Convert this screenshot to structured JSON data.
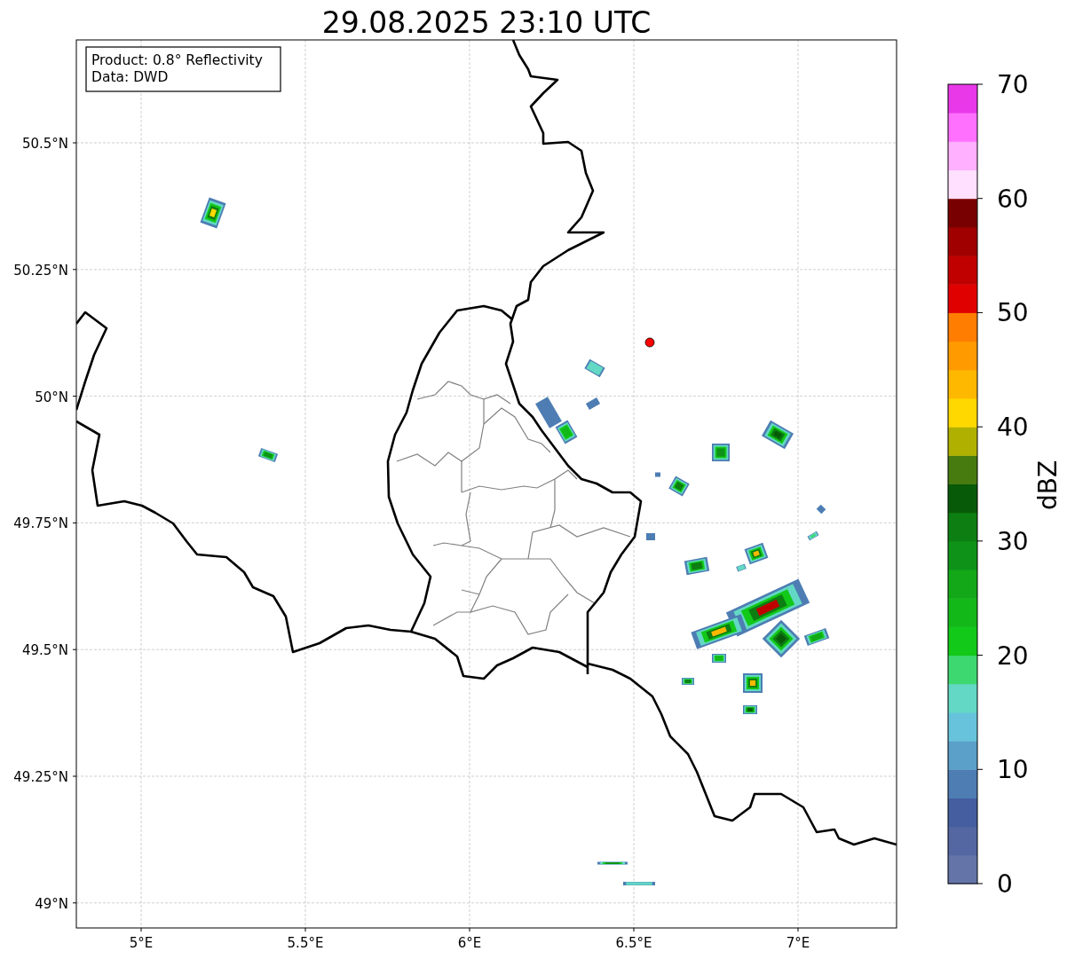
{
  "title": "29.08.2025 23:10 UTC",
  "info_box": [
    "Product: 0.8° Reflectivity",
    "Data: DWD"
  ],
  "x_ticks": [
    "5°E",
    "5.5°E",
    "6°E",
    "6.5°E",
    "7°E"
  ],
  "y_ticks": [
    "50.5°N",
    "50.25°N",
    "50°N",
    "49.75°N",
    "49.5°N",
    "49.25°N",
    "49°N"
  ],
  "colorbar": {
    "label": "dBZ",
    "ticks": [
      "70",
      "60",
      "50",
      "40",
      "30",
      "20",
      "10",
      "0"
    ]
  }
}
